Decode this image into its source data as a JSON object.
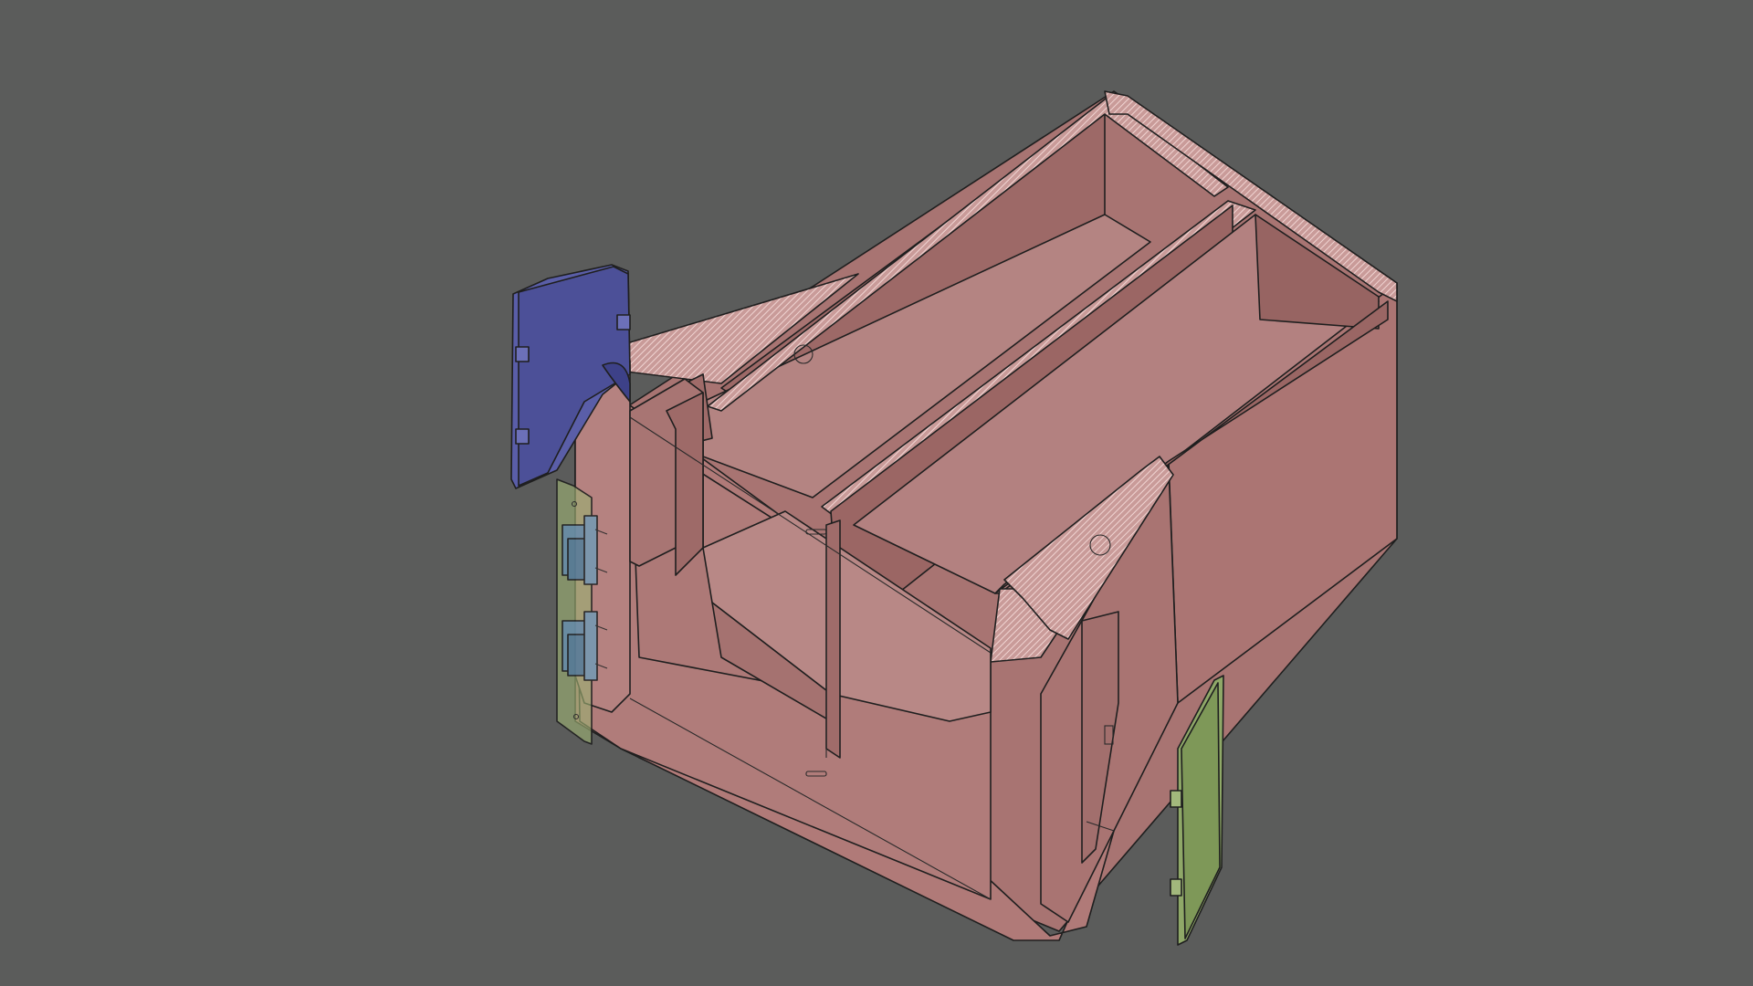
{
  "viewport": {
    "background": "#5b5c5b",
    "view": "3d-model-viewport"
  },
  "parts": {
    "enclosure": {
      "color": "#b07a78",
      "shade": "#9a6a68",
      "dark": "#8a5e5c",
      "section_hatch": "#e8c4c2"
    },
    "left_cover_plate": {
      "color": "#5a5ea8"
    },
    "connector_board": {
      "color": "#9bae72",
      "connector_color": "#6b8fa8"
    },
    "right_cover_plate": {
      "color": "#8fa868"
    }
  }
}
